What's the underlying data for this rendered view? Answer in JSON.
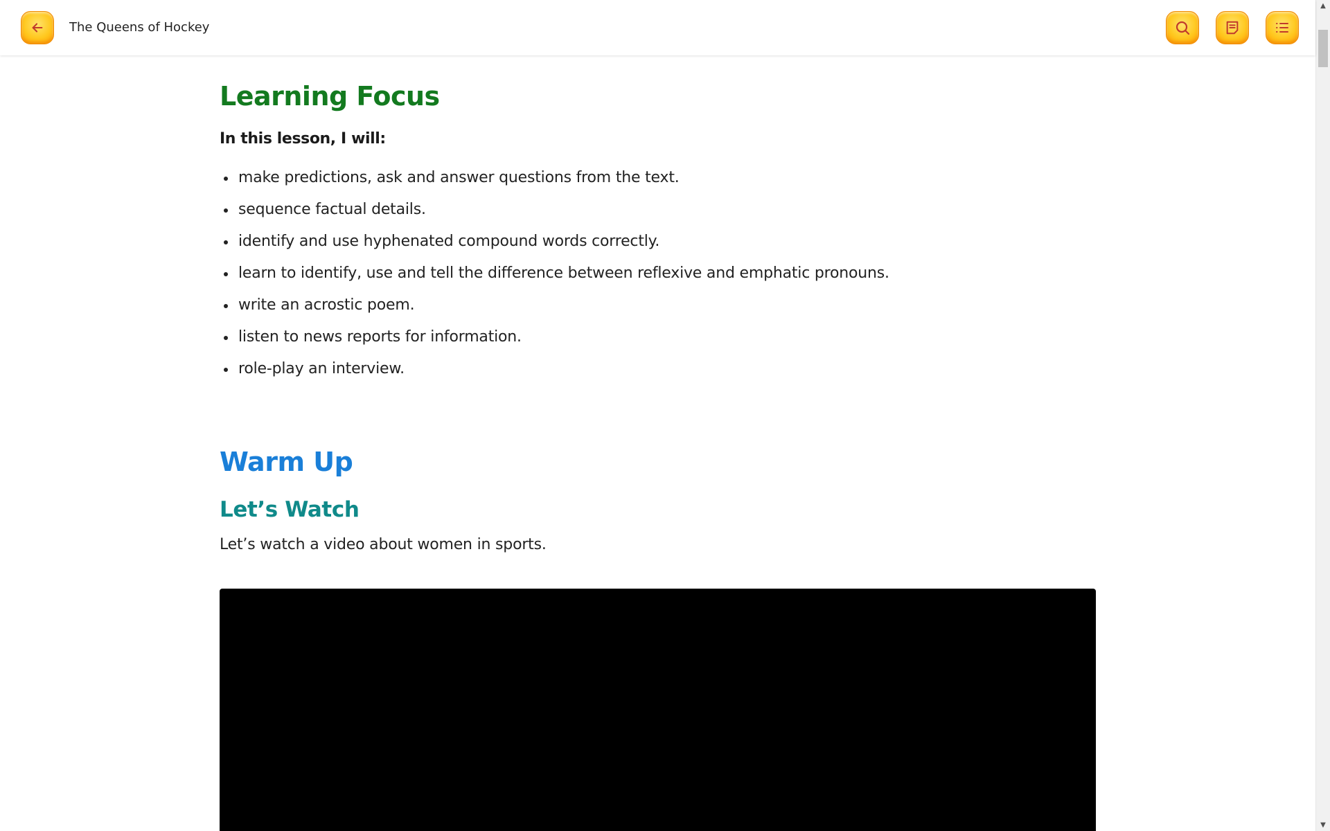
{
  "header": {
    "title": "The Queens of Hockey",
    "back_icon": "arrow-left-icon",
    "search_icon": "search-icon",
    "notes_icon": "notes-icon",
    "menu_icon": "list-icon"
  },
  "colors": {
    "button_fill": "#ffc81f",
    "button_border": "#f08a00",
    "icon_color": "#c0392b",
    "learning_focus_heading": "#137a1f",
    "warm_up_heading": "#1a7fd8",
    "lets_watch_heading": "#108a8a"
  },
  "learning_focus": {
    "heading": "Learning Focus",
    "intro": "In this lesson, I will:",
    "goals": [
      "make predictions, ask and answer questions from the text.",
      "sequence factual details.",
      "identify and use hyphenated compound words correctly.",
      "learn to identify, use and tell the difference between reflexive and emphatic pronouns.",
      "write an acrostic poem.",
      "listen to news reports for information.",
      "role-play an interview."
    ]
  },
  "warm_up": {
    "heading": "Warm Up",
    "subheading": "Let’s Watch",
    "text": "Let’s watch a video about women in sports."
  }
}
